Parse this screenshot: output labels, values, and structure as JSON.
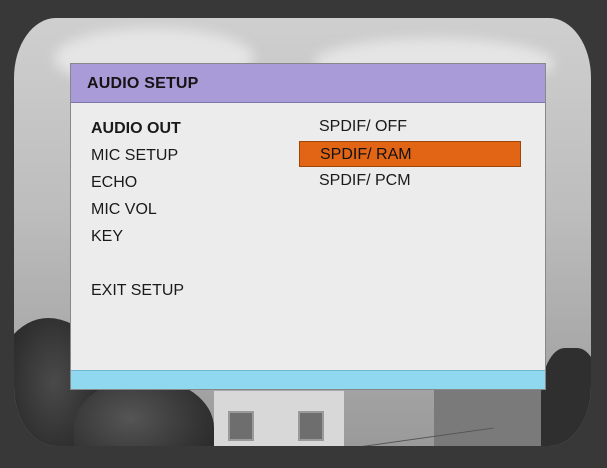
{
  "osd": {
    "title": "AUDIO SETUP",
    "menu_items": [
      {
        "label": "AUDIO OUT",
        "active": true
      },
      {
        "label": "MIC SETUP",
        "active": false
      },
      {
        "label": "ECHO",
        "active": false
      },
      {
        "label": "MIC VOL",
        "active": false
      },
      {
        "label": "KEY",
        "active": false
      },
      {
        "label": "EXIT SETUP",
        "active": false
      }
    ],
    "options": [
      {
        "label": "SPDIF/ OFF",
        "selected": false
      },
      {
        "label": "SPDIF/ RAM",
        "selected": true
      },
      {
        "label": "SPDIF/ PCM",
        "selected": false
      }
    ]
  },
  "colors": {
    "header": "#a99ad8",
    "panel": "#ececec",
    "highlight": "#e26515",
    "footer": "#90d8f0",
    "bezel": "#383838"
  }
}
